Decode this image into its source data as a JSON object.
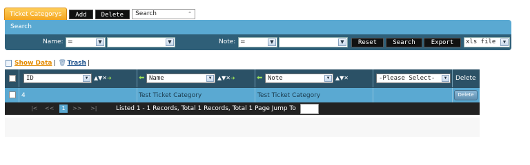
{
  "tabs": {
    "active_label": "Ticket Categorys",
    "add_label": "Add",
    "delete_label": "Delete",
    "view_select": "Search"
  },
  "search": {
    "title": "Search",
    "name_label": "Name:",
    "name_operator": "=",
    "name_value": "",
    "note_label": "Note:",
    "note_operator": "=",
    "note_value": "",
    "reset_label": "Reset",
    "search_label": "Search",
    "export_label": "Export",
    "export_format": "xls file"
  },
  "view_links": {
    "show_label": "Show Data",
    "sep1": "|",
    "trash_label": "Trash",
    "sep2": "|"
  },
  "grid": {
    "columns": {
      "id_select": "ID",
      "name_select": "Name",
      "note_select": "Note",
      "extra_select": "-Please Select-",
      "delete_header": "Delete"
    },
    "sort_icons": "▲▼✕",
    "rows": [
      {
        "id": "4",
        "name": "Test Ticket Category",
        "note": "Test Ticket Category",
        "action": "Delete"
      }
    ]
  },
  "pager": {
    "first": "|<",
    "prev": "<<",
    "current": "1",
    "next": ">>",
    "last": ">|",
    "info": "Listed 1 - 1 Records, Total 1 Records, Total 1 Page Jump To"
  },
  "colors": {
    "accent_orange": "#f3a520",
    "panel_blue": "#5aa9d2",
    "header_dark": "#2b5166"
  }
}
